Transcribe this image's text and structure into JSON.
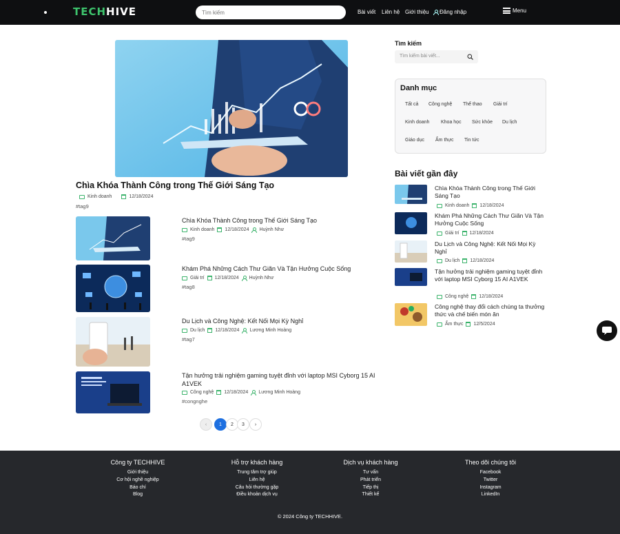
{
  "header": {
    "logo_part1": "TECH",
    "logo_part2": "HIVE",
    "search_placeholder": "Tìm kiếm",
    "nav": [
      "Bài viết",
      "Liên hệ",
      "Giới thiệu",
      "Đăng nhập"
    ],
    "menu_label": "Menu"
  },
  "featured": {
    "title": "Chìa Khóa Thành Công trong Thế Giới Sáng Tạo",
    "category": "Kinh doanh",
    "date": "12/18/2024",
    "tag": "#tag9"
  },
  "posts": [
    {
      "title": "Chìa Khóa Thành Công trong Thế Giới Sáng Tạo",
      "category": "Kinh doanh",
      "date": "12/18/2024",
      "author": "Huỳnh Như",
      "tag": "#tag9"
    },
    {
      "title": "Khám Phá Những Cách Thư Giãn Và Tận Hưởng Cuộc Sống",
      "category": "Giải trí",
      "date": "12/18/2024",
      "author": "Huỳnh Như",
      "tag": "#tag8"
    },
    {
      "title": "Du Lịch và Công Nghệ: Kết Nối Mọi Kỳ Nghỉ",
      "category": "Du lịch",
      "date": "12/18/2024",
      "author": "Lương Minh Hoàng",
      "tag": "#tag7"
    },
    {
      "title": "Tận hưởng trải nghiệm gaming tuyệt đỉnh với laptop MSI Cyborg 15 AI A1VEK",
      "category": "Công nghệ",
      "date": "12/18/2024",
      "author": "Lương Minh Hoàng",
      "tag": "#congnghe"
    }
  ],
  "pagination": {
    "pages": [
      "1",
      "2",
      "3"
    ],
    "current": "1"
  },
  "sidebar": {
    "search_label": "Tìm kiếm",
    "search_placeholder": "Tìm kiếm bài viết...",
    "categories_title": "Danh mục",
    "categories": [
      "Tất cả",
      "Công nghệ",
      "Thể thao",
      "Giải trí",
      "Kinh doanh",
      "Khoa học",
      "Sức khỏe",
      "Du lịch",
      "Giáo dục",
      "Ẩm thực",
      "Tin tức"
    ],
    "recent_title": "Bài viết gần đây",
    "recent": [
      {
        "title": "Chìa Khóa Thành Công trong Thế Giới Sáng Tạo",
        "category": "Kinh doanh",
        "date": "12/18/2024"
      },
      {
        "title": "Khám Phá Những Cách Thư Giãn Và Tận Hưởng Cuộc Sống",
        "category": "Giải trí",
        "date": "12/18/2024"
      },
      {
        "title": "Du Lịch và Công Nghệ: Kết Nối Mọi Kỳ Nghỉ",
        "category": "Du lịch",
        "date": "12/18/2024"
      },
      {
        "title": "Tận hưởng trải nghiệm gaming tuyệt đỉnh với laptop MSI Cyborg 15 AI A1VEK",
        "category": "Công nghệ",
        "date": "12/18/2024"
      },
      {
        "title": "Công nghệ thay đổi cách chúng ta thưởng thức và chế biến món ăn",
        "category": "Ẩm thực",
        "date": "12/5/2024"
      }
    ]
  },
  "footer": {
    "columns": [
      {
        "title": "Công ty TECHHIVE",
        "links": [
          "Giới thiệu",
          "Cơ hội nghề nghiệp",
          "Báo chí",
          "Blog"
        ]
      },
      {
        "title": "Hỗ trợ khách hàng",
        "links": [
          "Trung tâm trợ giúp",
          "Liên hệ",
          "Câu hỏi thường gặp",
          "Điều khoản dịch vụ"
        ]
      },
      {
        "title": "Dịch vụ khách hàng",
        "links": [
          "Tư vấn",
          "Phát triển",
          "Tiếp thị",
          "Thiết kế"
        ]
      },
      {
        "title": "Theo dõi chúng tôi",
        "links": [
          "Facebook",
          "Twitter",
          "Instagram",
          "LinkedIn"
        ]
      }
    ],
    "copyright": "© 2024 Công ty TECHHIVE."
  },
  "colors": {
    "accent": "#3ec46d",
    "pagination_active": "#1d6fe0",
    "header_bg": "#0e0f11",
    "footer_bg": "#26282c"
  }
}
